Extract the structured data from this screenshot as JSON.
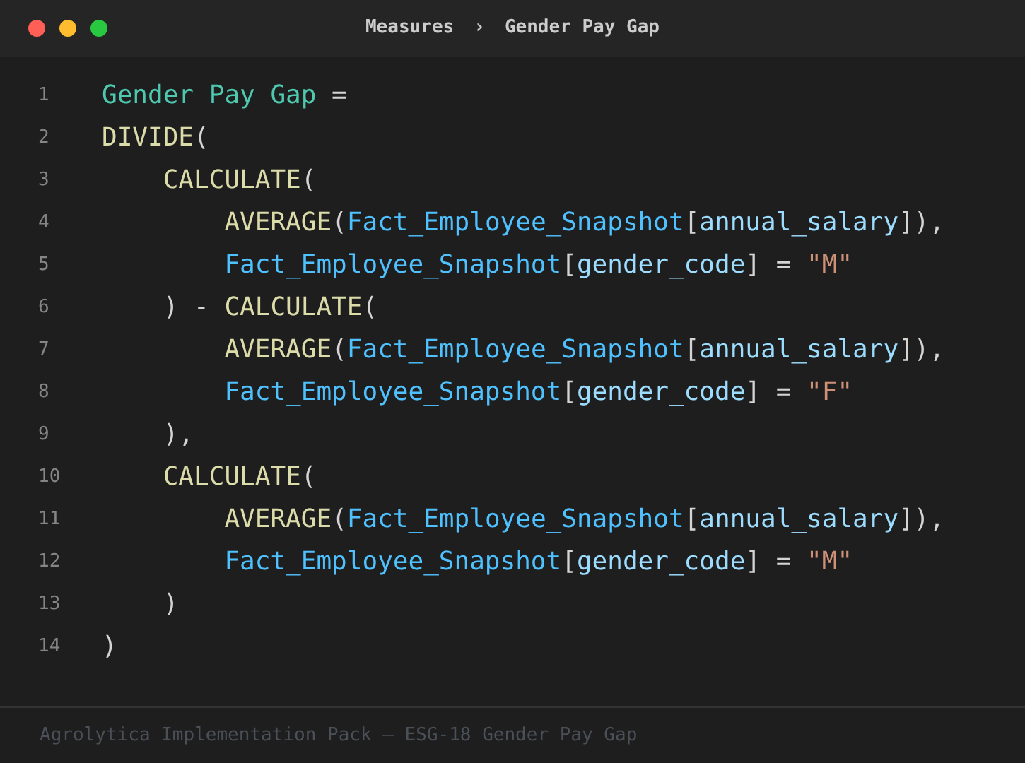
{
  "title_bar": {
    "breadcrumb": [
      "Measures",
      "Gender Pay Gap"
    ],
    "separator": "›"
  },
  "code": [
    {
      "number": "1",
      "tokens": [
        {
          "kind": "measure",
          "text": "Gender Pay Gap"
        },
        {
          "kind": "plain",
          "text": " ="
        }
      ]
    },
    {
      "number": "2",
      "tokens": [
        {
          "kind": "function",
          "text": "DIVIDE"
        },
        {
          "kind": "plain",
          "text": "("
        }
      ]
    },
    {
      "number": "3",
      "tokens": [
        {
          "kind": "function",
          "text": "    CALCULATE"
        },
        {
          "kind": "plain",
          "text": "("
        }
      ]
    },
    {
      "number": "4",
      "tokens": [
        {
          "kind": "function",
          "text": "        AVERAGE"
        },
        {
          "kind": "plain",
          "text": "("
        },
        {
          "kind": "table",
          "text": "Fact_Employee_Snapshot"
        },
        {
          "kind": "plain",
          "text": "["
        },
        {
          "kind": "column",
          "text": "annual_salary"
        },
        {
          "kind": "plain",
          "text": "]),"
        }
      ]
    },
    {
      "number": "5",
      "tokens": [
        {
          "kind": "table",
          "text": "        Fact_Employee_Snapshot"
        },
        {
          "kind": "plain",
          "text": "["
        },
        {
          "kind": "column",
          "text": "gender_code"
        },
        {
          "kind": "plain",
          "text": "] = "
        },
        {
          "kind": "string",
          "text": "\"M\""
        }
      ]
    },
    {
      "number": "6",
      "tokens": [
        {
          "kind": "plain",
          "text": "    ) - "
        },
        {
          "kind": "function",
          "text": "CALCULATE"
        },
        {
          "kind": "plain",
          "text": "("
        }
      ]
    },
    {
      "number": "7",
      "tokens": [
        {
          "kind": "function",
          "text": "        AVERAGE"
        },
        {
          "kind": "plain",
          "text": "("
        },
        {
          "kind": "table",
          "text": "Fact_Employee_Snapshot"
        },
        {
          "kind": "plain",
          "text": "["
        },
        {
          "kind": "column",
          "text": "annual_salary"
        },
        {
          "kind": "plain",
          "text": "]),"
        }
      ]
    },
    {
      "number": "8",
      "tokens": [
        {
          "kind": "table",
          "text": "        Fact_Employee_Snapshot"
        },
        {
          "kind": "plain",
          "text": "["
        },
        {
          "kind": "column",
          "text": "gender_code"
        },
        {
          "kind": "plain",
          "text": "] = "
        },
        {
          "kind": "string",
          "text": "\"F\""
        }
      ]
    },
    {
      "number": "9",
      "tokens": [
        {
          "kind": "plain",
          "text": "    ),"
        }
      ]
    },
    {
      "number": "10",
      "tokens": [
        {
          "kind": "function",
          "text": "    CALCULATE"
        },
        {
          "kind": "plain",
          "text": "("
        }
      ]
    },
    {
      "number": "11",
      "tokens": [
        {
          "kind": "function",
          "text": "        AVERAGE"
        },
        {
          "kind": "plain",
          "text": "("
        },
        {
          "kind": "table",
          "text": "Fact_Employee_Snapshot"
        },
        {
          "kind": "plain",
          "text": "["
        },
        {
          "kind": "column",
          "text": "annual_salary"
        },
        {
          "kind": "plain",
          "text": "]),"
        }
      ]
    },
    {
      "number": "12",
      "tokens": [
        {
          "kind": "table",
          "text": "        Fact_Employee_Snapshot"
        },
        {
          "kind": "plain",
          "text": "["
        },
        {
          "kind": "column",
          "text": "gender_code"
        },
        {
          "kind": "plain",
          "text": "] = "
        },
        {
          "kind": "string",
          "text": "\"M\""
        }
      ]
    },
    {
      "number": "13",
      "tokens": [
        {
          "kind": "plain",
          "text": "    )"
        }
      ]
    },
    {
      "number": "14",
      "tokens": [
        {
          "kind": "plain",
          "text": ")"
        }
      ]
    }
  ],
  "footer": "Agrolytica Implementation Pack — ESG-18 Gender Pay Gap"
}
